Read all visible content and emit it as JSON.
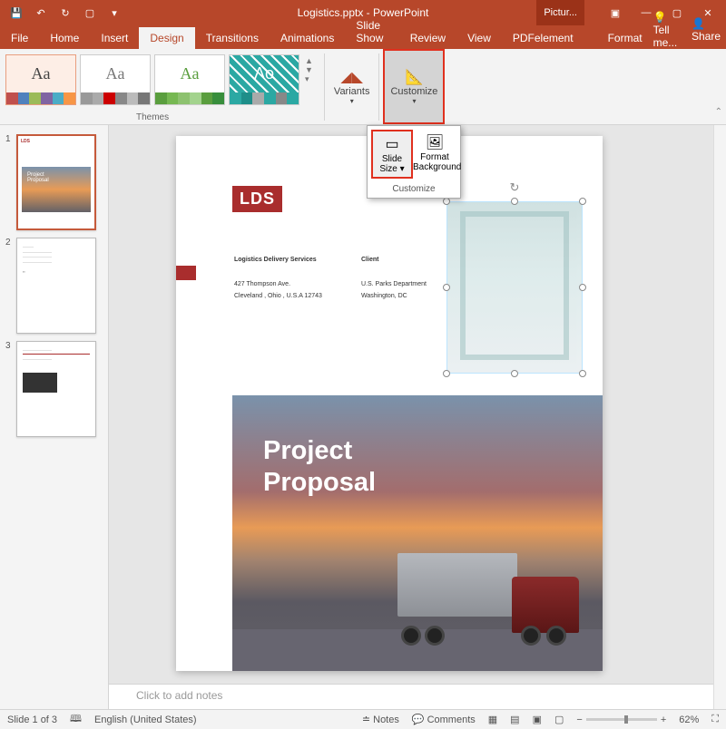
{
  "title": "Logistics.pptx - PowerPoint",
  "pictureTools": "Pictur...",
  "tabs": {
    "file": "File",
    "home": "Home",
    "insert": "Insert",
    "design": "Design",
    "transitions": "Transitions",
    "animations": "Animations",
    "slideshow": "Slide Show",
    "review": "Review",
    "view": "View",
    "pdfelement": "PDFelement",
    "format": "Format"
  },
  "tellme": "Tell me...",
  "share": "Share",
  "ribbon": {
    "themes_label": "Themes",
    "variants": "Variants",
    "customize": "Customize"
  },
  "dropdown": {
    "slide_size": "Slide Size",
    "format_bg": "Format Background",
    "customize": "Customize"
  },
  "thumbs": [
    "1",
    "2",
    "3"
  ],
  "slide": {
    "lds": "LDS",
    "company": "Logistics Delivery Services",
    "addr1": "427 Thompson Ave.",
    "addr2": "Cleveland , Ohio , U.S.A 12743",
    "client_h": "Client",
    "client1": "U.S. Parks Department",
    "client2": "Washington, DC",
    "hero1": "Project",
    "hero2": "Proposal"
  },
  "notes": "Click to add notes",
  "status": {
    "slide": "Slide 1 of 3",
    "lang": "English (United States)",
    "notes": "Notes",
    "comments": "Comments",
    "zoom": "62%"
  }
}
